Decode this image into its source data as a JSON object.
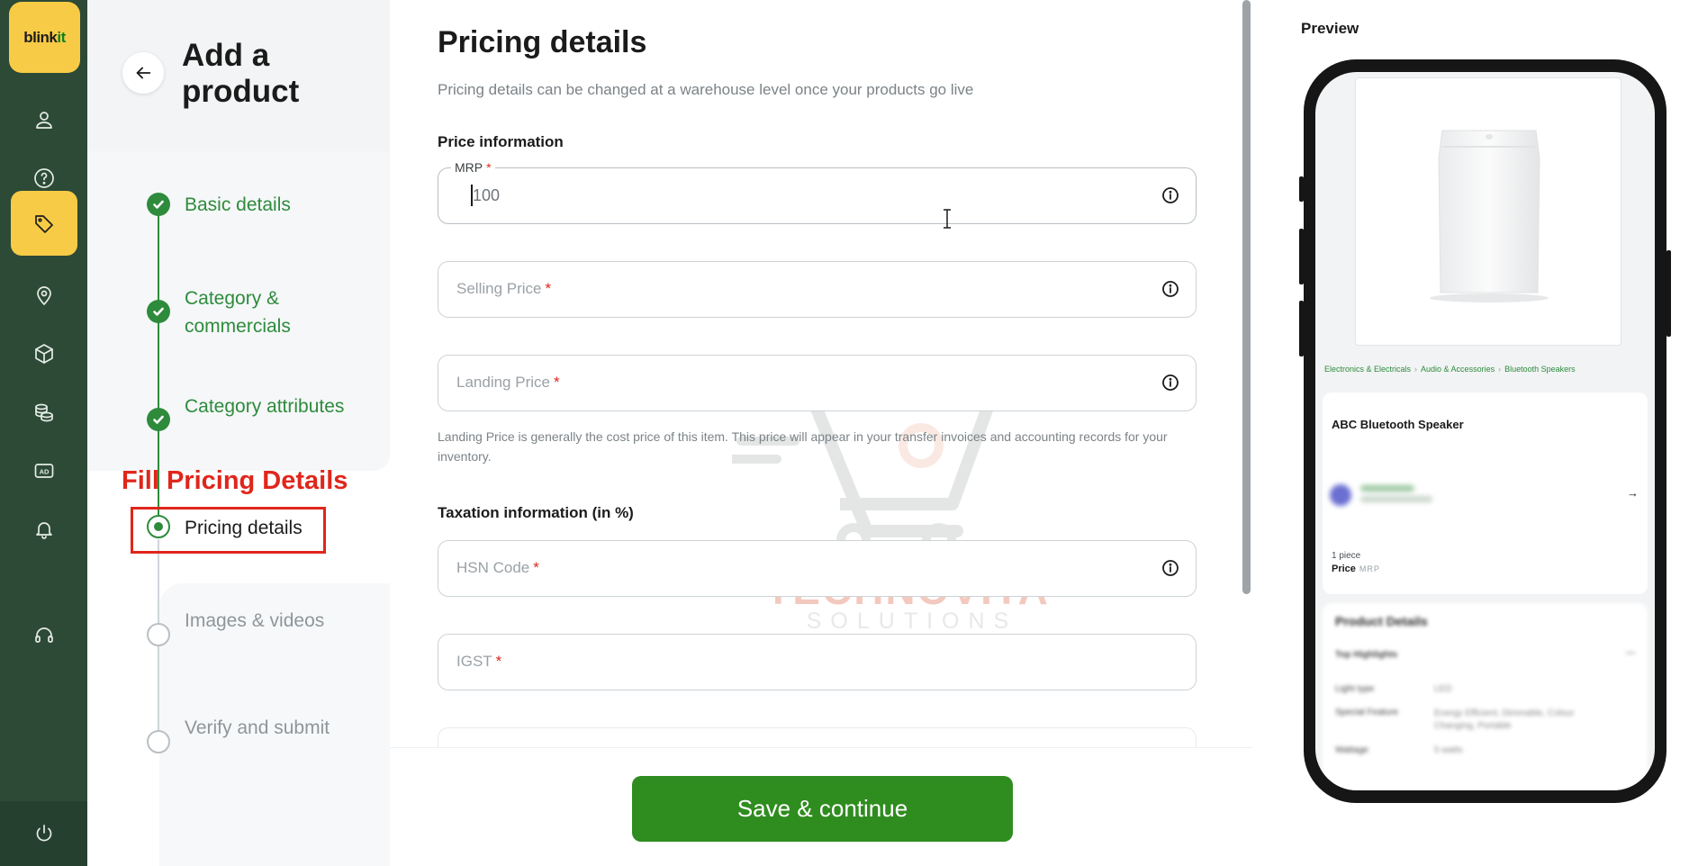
{
  "app": {
    "logo_text": "blink",
    "logo_text_accent": "it",
    "brand_yellow": "#f8cb46",
    "brand_green": "#2e8b3c",
    "rail_color": "#2d4a36"
  },
  "rail": {
    "items": [
      {
        "icon": "user-icon"
      },
      {
        "icon": "help-icon"
      },
      {
        "icon": "tag-icon",
        "active": true
      },
      {
        "icon": "location-pin-icon"
      },
      {
        "icon": "box-icon"
      },
      {
        "icon": "coins-icon"
      },
      {
        "icon": "ad-icon",
        "text": "AD"
      },
      {
        "icon": "bell-icon"
      },
      {
        "icon": "headset-icon"
      }
    ],
    "bottom_icon": "power-icon"
  },
  "stepper": {
    "title": "Add a product",
    "back_icon": "arrow-left-icon",
    "steps": [
      {
        "label": "Basic details",
        "state": "done"
      },
      {
        "label": "Category & commercials",
        "state": "done"
      },
      {
        "label": "Category attributes",
        "state": "done"
      },
      {
        "label": "Pricing details",
        "state": "current"
      },
      {
        "label": "Images & videos",
        "state": "todo"
      },
      {
        "label": "Verify and submit",
        "state": "todo"
      }
    ],
    "annotation": "Fill Pricing Details",
    "annotation_color": "#e0261b"
  },
  "form": {
    "title": "Pricing details",
    "subtitle": "Pricing details can be changed at a warehouse level once your products go live",
    "price_section": "Price information",
    "mrp": {
      "label": "MRP",
      "value": "100",
      "required": "*"
    },
    "selling_price": {
      "placeholder": "Selling Price",
      "required": "*"
    },
    "landing_price": {
      "placeholder": "Landing Price",
      "required": "*"
    },
    "landing_help": "Landing Price is generally the cost price of this item. This price will appear in your transfer invoices and accounting records for your inventory.",
    "tax_section": "Taxation information (in %)",
    "hsn": {
      "placeholder": "HSN Code",
      "required": "*"
    },
    "igst": {
      "placeholder": "IGST",
      "required": "*"
    },
    "save_label": "Save & continue",
    "save_color": "#2f8c1f"
  },
  "watermark": {
    "title": "TECHNOVITA",
    "subtitle": "SOLUTIONS"
  },
  "preview": {
    "title": "Preview",
    "breadcrumbs": [
      "Electronics & Electricals",
      "Audio & Accessories",
      "Bluetooth Speakers"
    ],
    "product_name": "ABC Bluetooth Speaker",
    "unit": "1 piece",
    "price_label": "Price",
    "mrp_label": "MRP",
    "details_title": "Product Details",
    "details": [
      {
        "key": "Top Highlights",
        "value": ""
      },
      {
        "key": "Light type",
        "value": "LED"
      },
      {
        "key": "Special Feature",
        "value": "Energy Efficient, Dimmable, Colour Changing, Portable"
      },
      {
        "key": "Wattage",
        "value": "5 watts"
      }
    ]
  }
}
